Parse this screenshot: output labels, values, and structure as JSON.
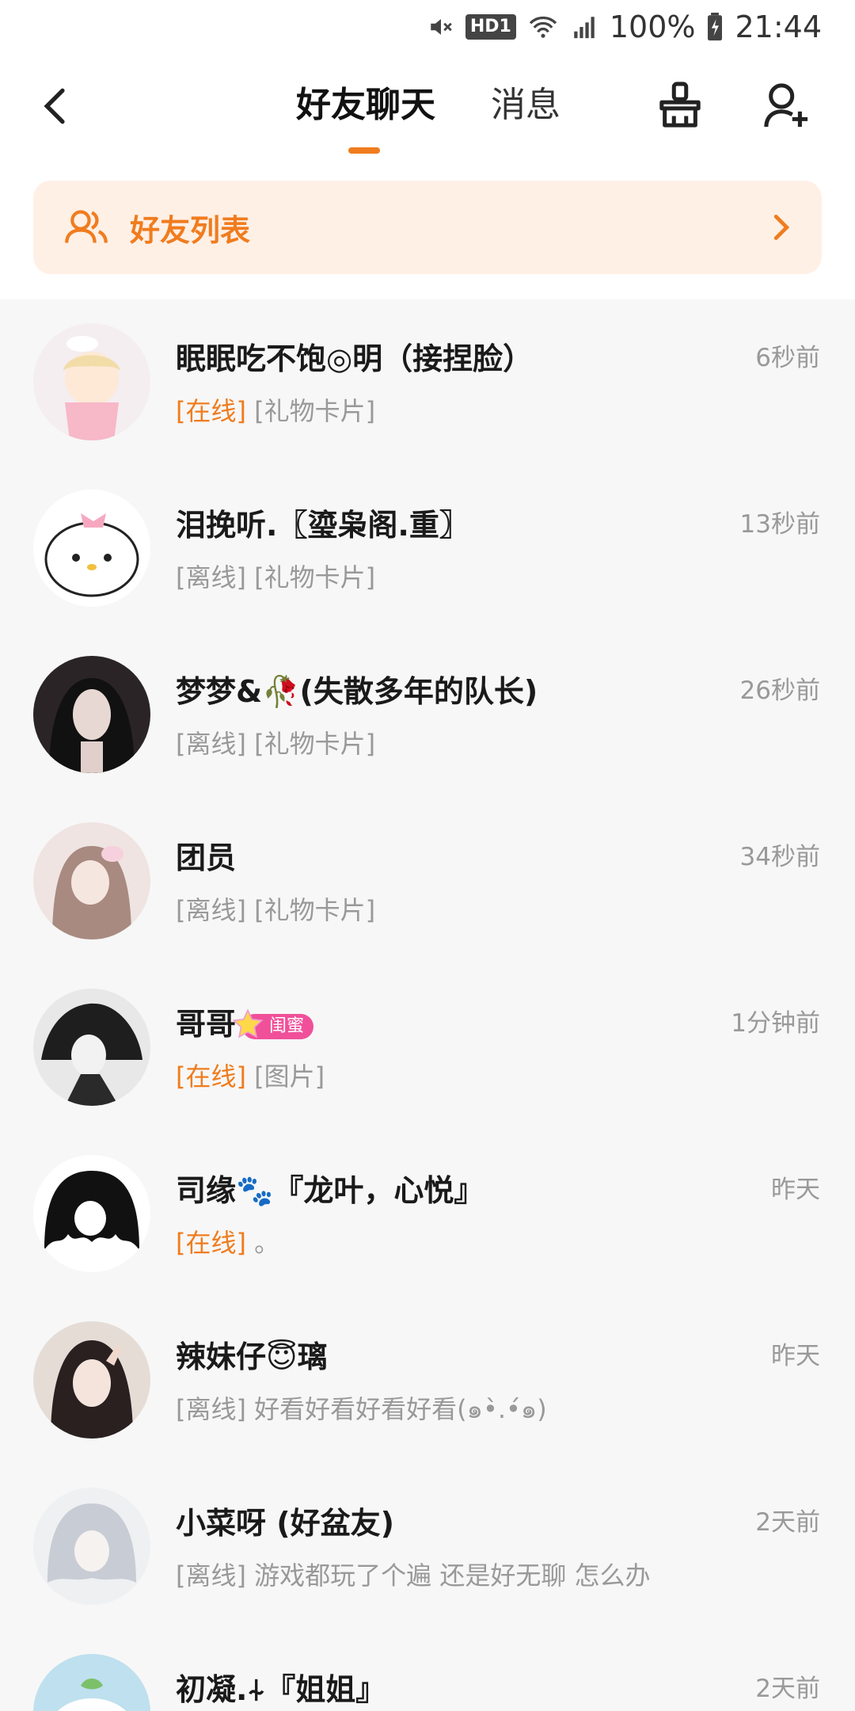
{
  "status_bar": {
    "battery": "100%",
    "time": "21:44",
    "hd_label": "HD1",
    "network": "4G",
    "icons": [
      "mute-icon",
      "hd-icon",
      "wifi-icon",
      "signal-icon",
      "battery-icon"
    ]
  },
  "header": {
    "tabs": [
      {
        "label": "好友聊天",
        "active": true
      },
      {
        "label": "消息",
        "active": false
      }
    ],
    "accent_color": "#f07c1e"
  },
  "friend_list_banner": {
    "label": "好友列表",
    "icon": "friends-icon"
  },
  "chats": [
    {
      "name": "眠眠吃不饱◎明（接捏脸）",
      "time": "6秒前",
      "status": "[在线]",
      "online": true,
      "message": "[礼物卡片]"
    },
    {
      "name": "泪挽听.〖瑬枭阁.重〗",
      "time": "13秒前",
      "status": "[离线]",
      "online": false,
      "message": "[礼物卡片]"
    },
    {
      "name": "梦梦&🥀(失散多年的队长)",
      "time": "26秒前",
      "status": "[离线]",
      "online": false,
      "message": "[礼物卡片]"
    },
    {
      "name": "团员",
      "time": "34秒前",
      "status": "[离线]",
      "online": false,
      "message": "[礼物卡片]"
    },
    {
      "name": "哥哥",
      "time": "1分钟前",
      "status": "[在线]",
      "online": true,
      "message": "[图片]",
      "badge": "闺蜜"
    },
    {
      "name": "司缘🐾『龙叶，心悦』",
      "time": "昨天",
      "status": "[在线]",
      "online": true,
      "message": "。"
    },
    {
      "name": "辣妹仔😇璃",
      "time": "昨天",
      "status": "[离线]",
      "online": false,
      "message": "好看好看好看好看(๑•̀.•́๑)"
    },
    {
      "name": "小菜呀 (好盆友)",
      "time": "2天前",
      "status": "[离线]",
      "online": false,
      "message": "游戏都玩了个遍 还是好无聊 怎么办"
    },
    {
      "name": "初凝.⍭『姐姐』",
      "time": "2天前",
      "status": "",
      "online": false,
      "message": ""
    }
  ]
}
